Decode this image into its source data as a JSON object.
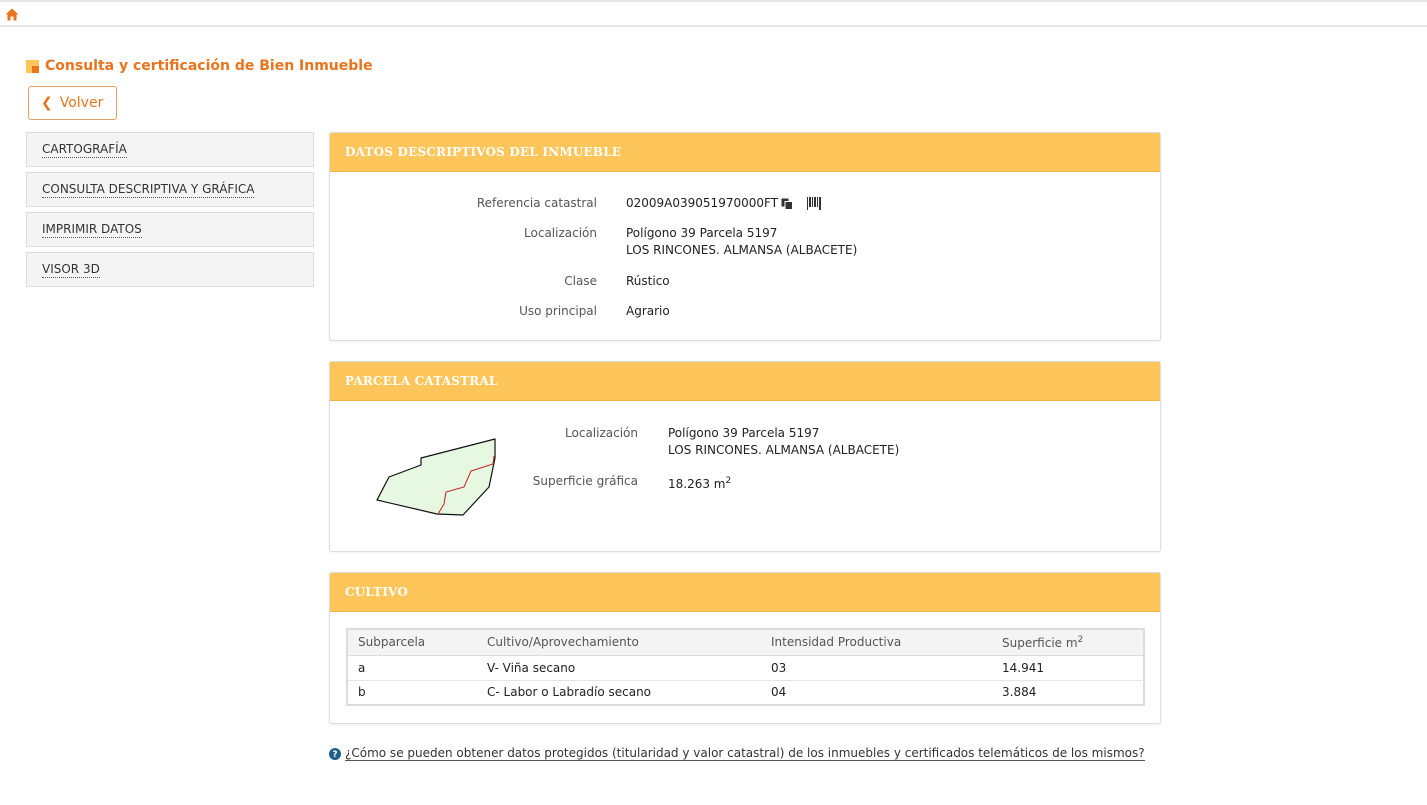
{
  "title": "Consulta y certificación de Bien Inmueble",
  "back_label": "Volver",
  "icons": {
    "home": "home-icon",
    "title": "square-icon",
    "back": "chevron-left-icon",
    "copy": "copy-icon",
    "barcode": "barcode-icon",
    "help": "question-circle-icon"
  },
  "colors": {
    "accent": "#e8741e",
    "header": "#fec55b"
  },
  "sidebar": {
    "items": [
      {
        "label": "CARTOGRAFÍA"
      },
      {
        "label": "CONSULTA DESCRIPTIVA Y GRÁFICA"
      },
      {
        "label": "IMPRIMIR DATOS"
      },
      {
        "label": "VISOR 3D"
      }
    ]
  },
  "datos": {
    "heading": "DATOS DESCRIPTIVOS DEL INMUEBLE",
    "ref_label": "Referencia catastral",
    "ref_value": "02009A039051970000FT",
    "loc_label": "Localización",
    "loc_line1": "Polígono 39 Parcela 5197",
    "loc_line2": "LOS RINCONES. ALMANSA (ALBACETE)",
    "clase_label": "Clase",
    "clase_value": "Rústico",
    "uso_label": "Uso principal",
    "uso_value": "Agrario"
  },
  "parcela": {
    "heading": "PARCELA CATASTRAL",
    "loc_label": "Localización",
    "loc_line1": "Polígono 39 Parcela 5197",
    "loc_line2": "LOS RINCONES. ALMANSA (ALBACETE)",
    "sup_label": "Superficie gráfica",
    "sup_value": "18.263 m",
    "sup_exp": "2"
  },
  "cultivo": {
    "heading": "CULTIVO",
    "columns": [
      "Subparcela",
      "Cultivo/Aprovechamiento",
      "Intensidad Productiva",
      "Superficie m"
    ],
    "columns_exp": "2",
    "rows": [
      {
        "sub": "a",
        "cultivo": "V- Viña secano",
        "intensidad": "03",
        "superficie": "14.941"
      },
      {
        "sub": "b",
        "cultivo": "C- Labor o Labradío secano",
        "intensidad": "04",
        "superficie": "3.884"
      }
    ]
  },
  "help_text": "¿Cómo se pueden obtener datos protegidos (titularidad y valor catastral) de los inmuebles y certificados telemáticos de los mismos?"
}
